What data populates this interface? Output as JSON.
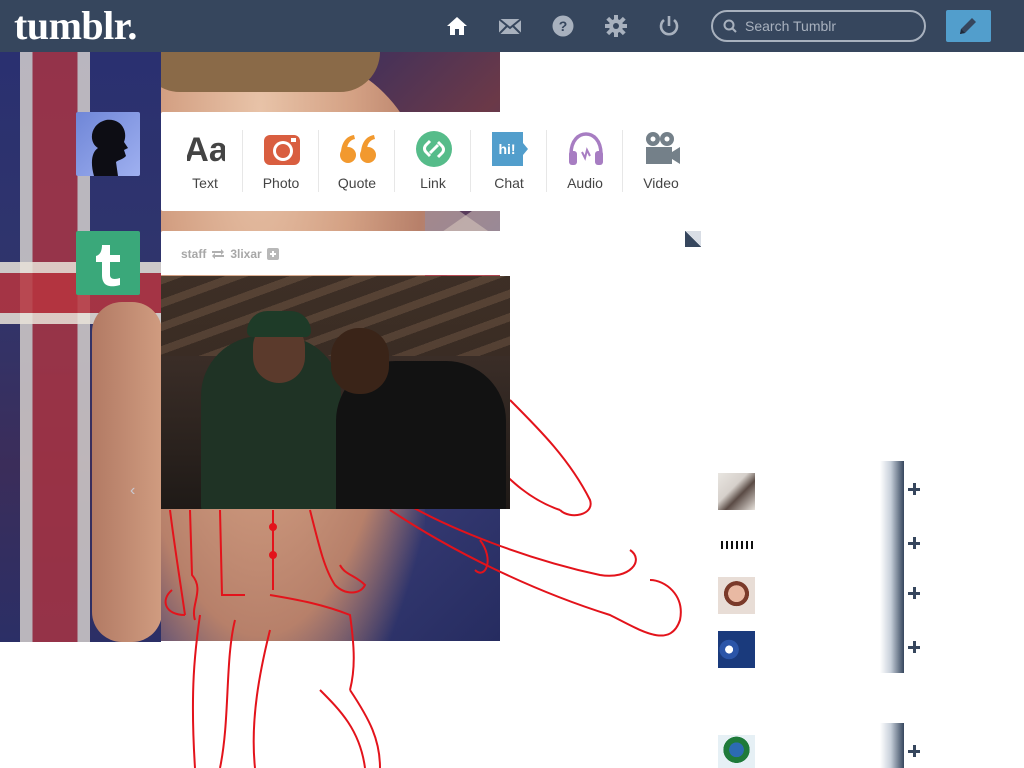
{
  "header": {
    "logo": "tumblr.",
    "search_placeholder": "Search Tumblr",
    "nav": [
      {
        "name": "home-icon"
      },
      {
        "name": "mail-icon"
      },
      {
        "name": "help-icon"
      },
      {
        "name": "gear-icon"
      },
      {
        "name": "power-icon"
      }
    ],
    "compose_icon": "pencil-icon"
  },
  "post_types": [
    {
      "label": "Text",
      "icon": "text-icon",
      "color": "#444444"
    },
    {
      "label": "Photo",
      "icon": "camera-icon",
      "color": "#d95e40"
    },
    {
      "label": "Quote",
      "icon": "quote-icon",
      "color": "#f2992e"
    },
    {
      "label": "Link",
      "icon": "link-icon",
      "color": "#56bc8a"
    },
    {
      "label": "Chat",
      "icon": "chat-icon",
      "color": "#529ecc"
    },
    {
      "label": "Audio",
      "icon": "headphones-icon",
      "color": "#a77dc2"
    },
    {
      "label": "Video",
      "icon": "video-camera-icon",
      "color": "#748089"
    }
  ],
  "post": {
    "author": "staff",
    "reblogged_from": "3lixar"
  },
  "colors": {
    "header_bg": "#36465d",
    "compose_bg": "#529ecc",
    "doodle": "#e3131b"
  }
}
